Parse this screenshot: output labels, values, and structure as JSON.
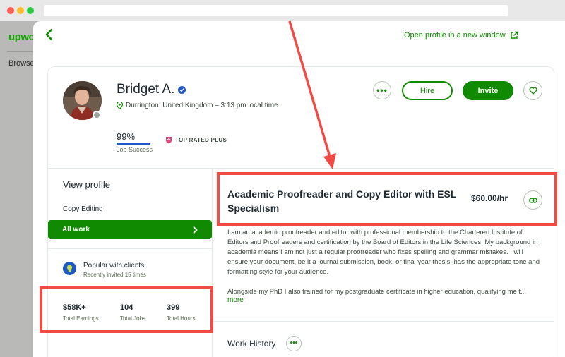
{
  "background_page": {
    "logo_text": "upwo",
    "browse_label": "Browse"
  },
  "panel": {
    "open_profile_label": "Open profile in a new window"
  },
  "profile": {
    "name": "Bridget A.",
    "location": "Durrington, United Kingdom – 3:13 pm local time",
    "job_success_value": "99%",
    "job_success_label": "Job Success",
    "job_success_fraction": 0.99,
    "badge": "TOP RATED PLUS"
  },
  "actions": {
    "hire_label": "Hire",
    "invite_label": "Invite"
  },
  "sidebar": {
    "view_profile": "View profile",
    "items": [
      {
        "label": "Copy Editing"
      },
      {
        "label": "All work"
      }
    ],
    "popular_title": "Popular with clients",
    "popular_sub": "Recently invited 15 times"
  },
  "stats": [
    {
      "value": "$58K+",
      "label": "Total Earnings"
    },
    {
      "value": "104",
      "label": "Total Jobs"
    },
    {
      "value": "399",
      "label": "Total Hours"
    }
  ],
  "main": {
    "title": "Academic Proofreader and Copy Editor with ESL Specialism",
    "rate": "$60.00/hr",
    "description_p1": "I am an academic proofreader and editor with professional membership to the Chartered Institute of Editors and Proofreaders and certification by the Board of Editors in the Life Sciences. My background in academia means I am not just a regular proofreader who fixes spelling and grammar mistakes. I will ensure your document, be it a journal submission, book, or final year thesis, has the appropriate tone and formatting style for your audience.",
    "description_p2": "Alongside my PhD I also trained for my postgraduate certificate in higher education, qualifying me t...",
    "more_label": "more",
    "work_history_label": "Work History"
  },
  "colors": {
    "brand_green": "#108a00",
    "annotation_red": "#f24a44",
    "job_success_blue": "#1f57c3",
    "badge_pink": "#e5467b"
  }
}
